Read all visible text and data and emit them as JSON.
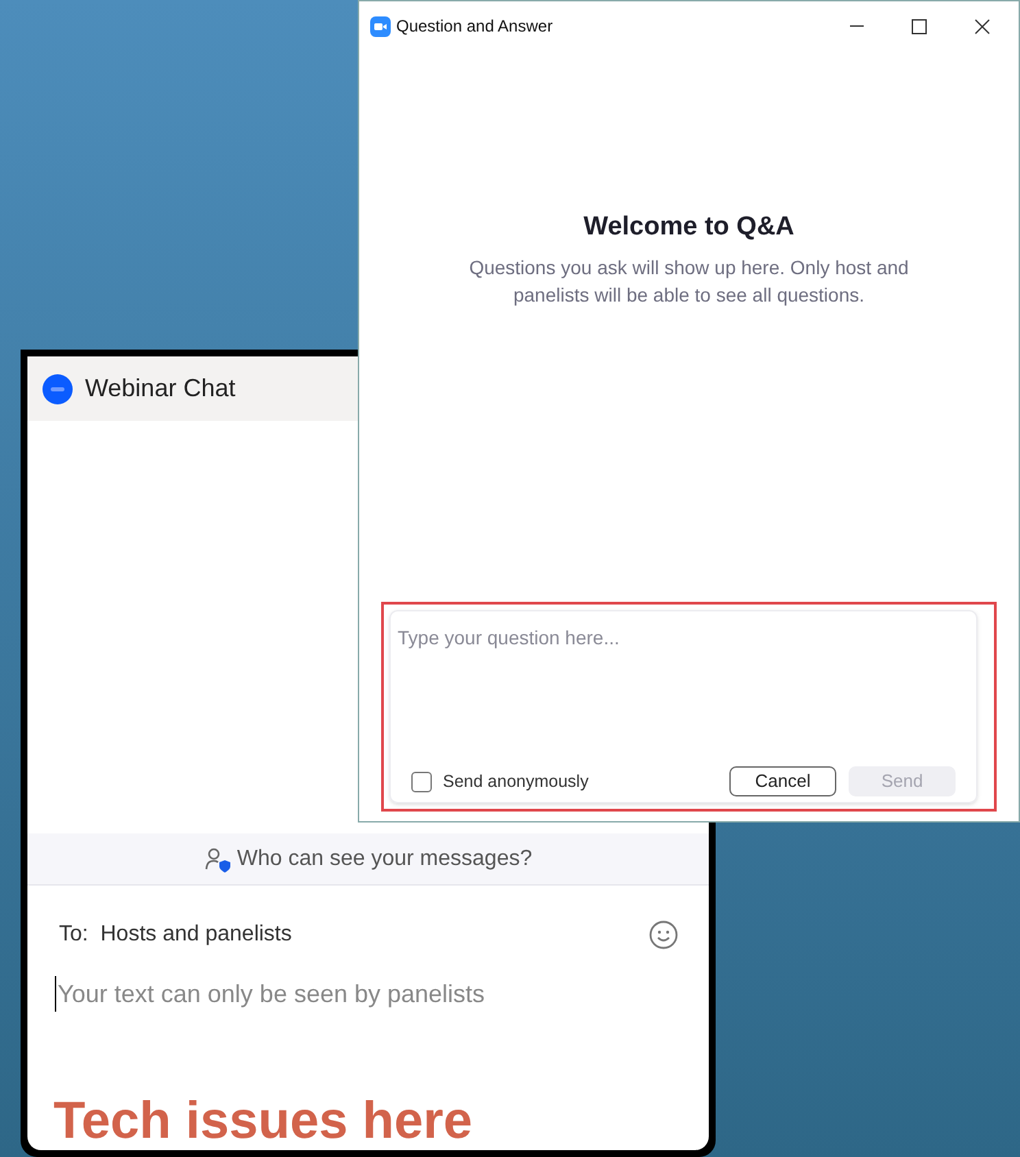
{
  "chat_window": {
    "title": "Webinar Chat",
    "privacy_bar": "Who can see your messages?",
    "to_label": "To:",
    "recipient": "Hosts and panelists",
    "message_placeholder": "Your text can only be seen by panelists"
  },
  "qa_window": {
    "title": "Question and Answer",
    "welcome_title": "Welcome to Q&A",
    "welcome_text": "Questions you ask will show up here. Only host and panelists will be able to see all questions.",
    "question_placeholder": "Type your question here...",
    "anonymous": {
      "label": "Send anonymously",
      "checked": false
    },
    "buttons": [
      {
        "label": "Cancel",
        "disabled": false
      },
      {
        "label": "Send",
        "disabled": true
      }
    ]
  },
  "annotation": "Tech issues here"
}
